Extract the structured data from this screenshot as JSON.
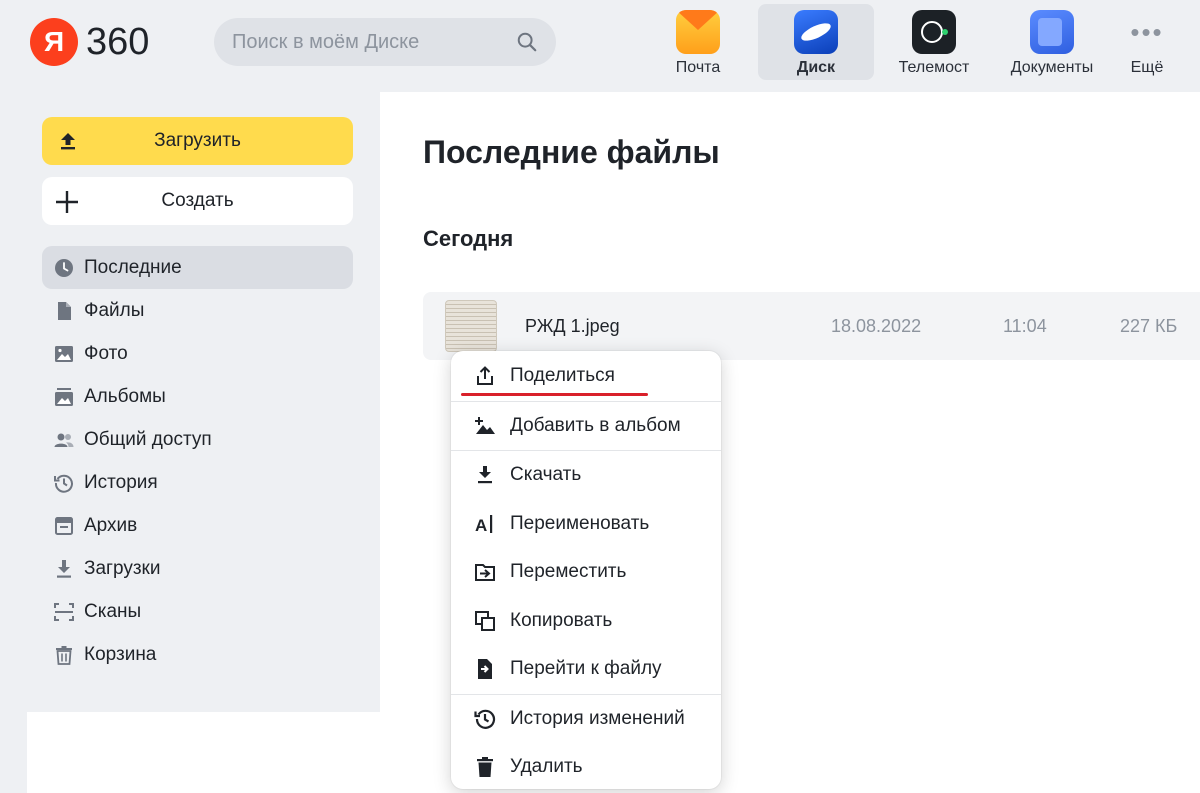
{
  "header": {
    "logo_letter": "Я",
    "logo_text": "360",
    "search_placeholder": "Поиск в моём Диске",
    "apps": [
      {
        "label": "Почта",
        "icon": "mail-icon"
      },
      {
        "label": "Диск",
        "icon": "disk-icon",
        "active": true
      },
      {
        "label": "Телемост",
        "icon": "telemost-icon"
      },
      {
        "label": "Документы",
        "icon": "documents-icon"
      },
      {
        "label": "Ещё",
        "icon": "more-icon"
      }
    ]
  },
  "sidebar": {
    "upload_label": "Загрузить",
    "create_label": "Создать",
    "items": [
      {
        "label": "Последние",
        "icon": "clock-icon",
        "active": true
      },
      {
        "label": "Файлы",
        "icon": "file-icon"
      },
      {
        "label": "Фото",
        "icon": "photo-icon"
      },
      {
        "label": "Альбомы",
        "icon": "albums-icon"
      },
      {
        "label": "Общий доступ",
        "icon": "shared-icon"
      },
      {
        "label": "История",
        "icon": "history-icon"
      },
      {
        "label": "Архив",
        "icon": "archive-icon"
      },
      {
        "label": "Загрузки",
        "icon": "downloads-icon"
      },
      {
        "label": "Сканы",
        "icon": "scan-icon"
      },
      {
        "label": "Корзина",
        "icon": "trash-icon"
      }
    ]
  },
  "main": {
    "title": "Последние файлы",
    "group_title": "Сегодня",
    "file": {
      "name": "РЖД 1.jpeg",
      "date": "18.08.2022",
      "time": "11:04",
      "size": "227 КБ"
    }
  },
  "context_menu": {
    "items": [
      {
        "label": "Поделиться",
        "icon": "share-icon"
      },
      {
        "label": "Добавить в альбом",
        "icon": "add-to-album-icon"
      },
      {
        "label": "Скачать",
        "icon": "download-icon"
      },
      {
        "label": "Переименовать",
        "icon": "rename-icon"
      },
      {
        "label": "Переместить",
        "icon": "move-icon"
      },
      {
        "label": "Копировать",
        "icon": "copy-icon"
      },
      {
        "label": "Перейти к файлу",
        "icon": "go-to-file-icon"
      },
      {
        "label": "История изменений",
        "icon": "version-history-icon"
      },
      {
        "label": "Удалить",
        "icon": "delete-icon"
      }
    ]
  },
  "colors": {
    "accent_yellow": "#ffdb4d",
    "logo_red": "#fc3f1d",
    "highlight_underline": "#d9202a",
    "background": "#eef0f3"
  }
}
